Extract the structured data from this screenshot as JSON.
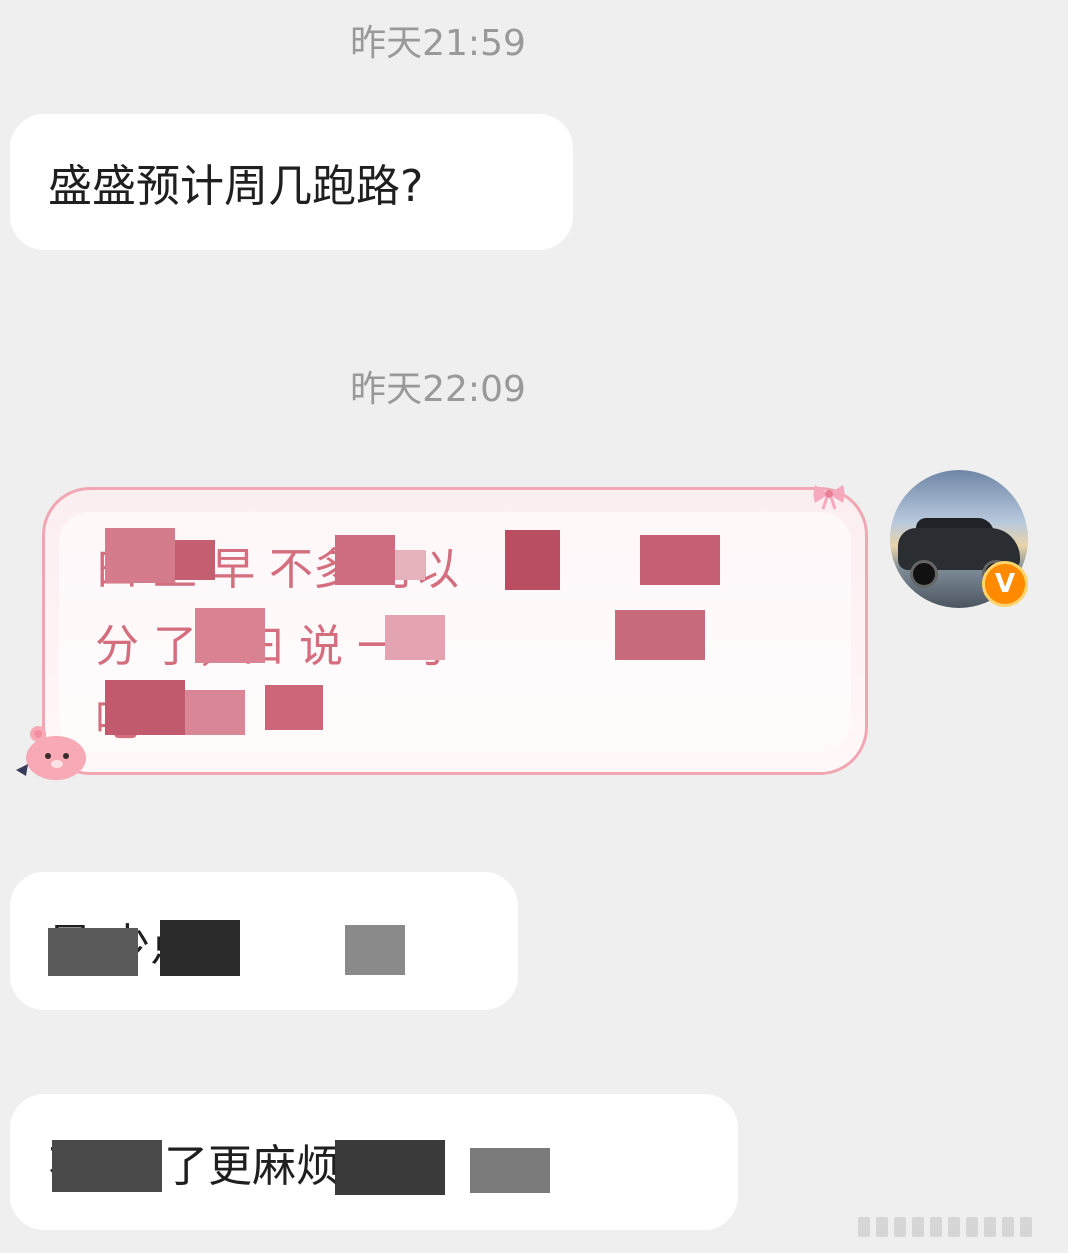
{
  "messages": {
    "time1": "昨天21:59",
    "msg1": "盛盛预计周几跑路?",
    "time2": "昨天22:09",
    "reply_line1": "曰   上   早    不多   可以",
    "reply_line2": "分   了，曰   说   一句",
    "reply_line3": "     吧",
    "msg2": "    是   少点",
    "msg3": "      不 曰     了更麻烦"
  },
  "avatar": {
    "badge_letter": "V",
    "badge_color": "#ff8a00"
  },
  "colors": {
    "background": "#efefef",
    "incoming_bubble": "#ffffff",
    "outgoing_border": "#f0a7b3",
    "outgoing_text": "#d46d7e",
    "timestamp": "#999999"
  },
  "icons": {
    "bubble_decoration": "pink-bow-icon",
    "bubble_sticker": "pink-bear-icon",
    "verified": "verified-badge-icon"
  }
}
